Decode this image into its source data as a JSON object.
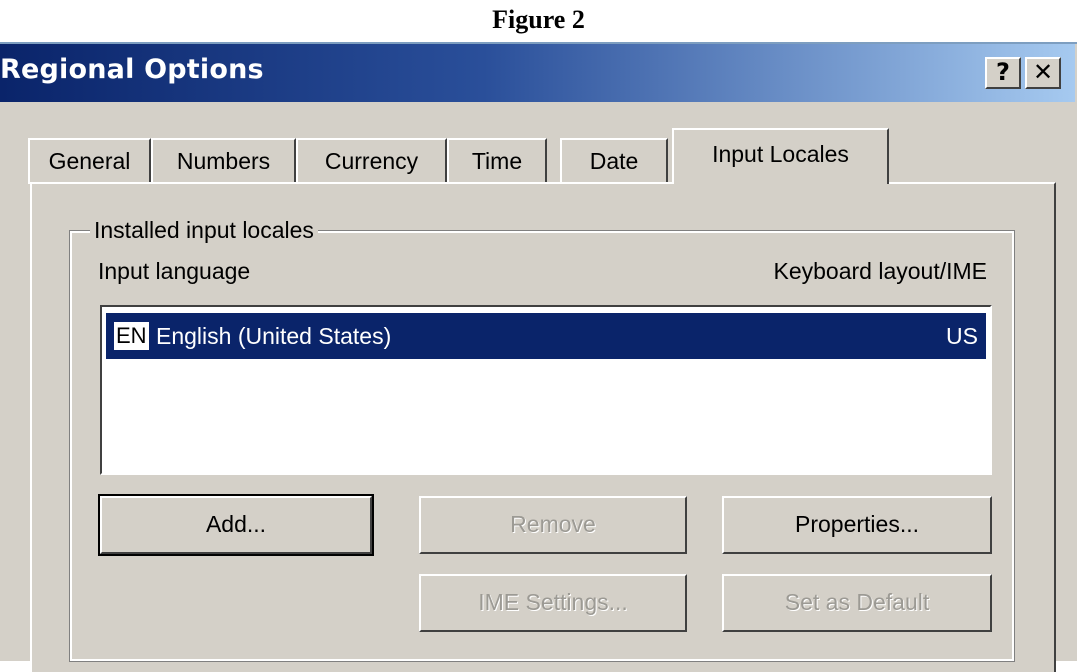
{
  "caption": "Figure 2",
  "window": {
    "title": "Regional Options",
    "help_label": "?",
    "close_label": "✕"
  },
  "tabs": [
    {
      "label": "General",
      "active": false
    },
    {
      "label": "Numbers",
      "active": false
    },
    {
      "label": "Currency",
      "active": false
    },
    {
      "label": "Time",
      "active": false
    },
    {
      "label": "Date",
      "active": false
    },
    {
      "label": "Input Locales",
      "active": true
    }
  ],
  "group": {
    "label": "Installed input locales",
    "col_input_language": "Input language",
    "col_keyboard_layout": "Keyboard layout/IME"
  },
  "locales": [
    {
      "badge": "EN",
      "language": "English (United States)",
      "layout": "US",
      "selected": true
    }
  ],
  "buttons": {
    "add": "Add...",
    "remove": "Remove",
    "properties": "Properties...",
    "ime_settings": "IME Settings...",
    "set_default": "Set as Default"
  },
  "colors": {
    "titlebar_start": "#0a246a",
    "titlebar_end": "#a6caf0",
    "selection": "#0a246a",
    "face": "#d4d0c8"
  }
}
